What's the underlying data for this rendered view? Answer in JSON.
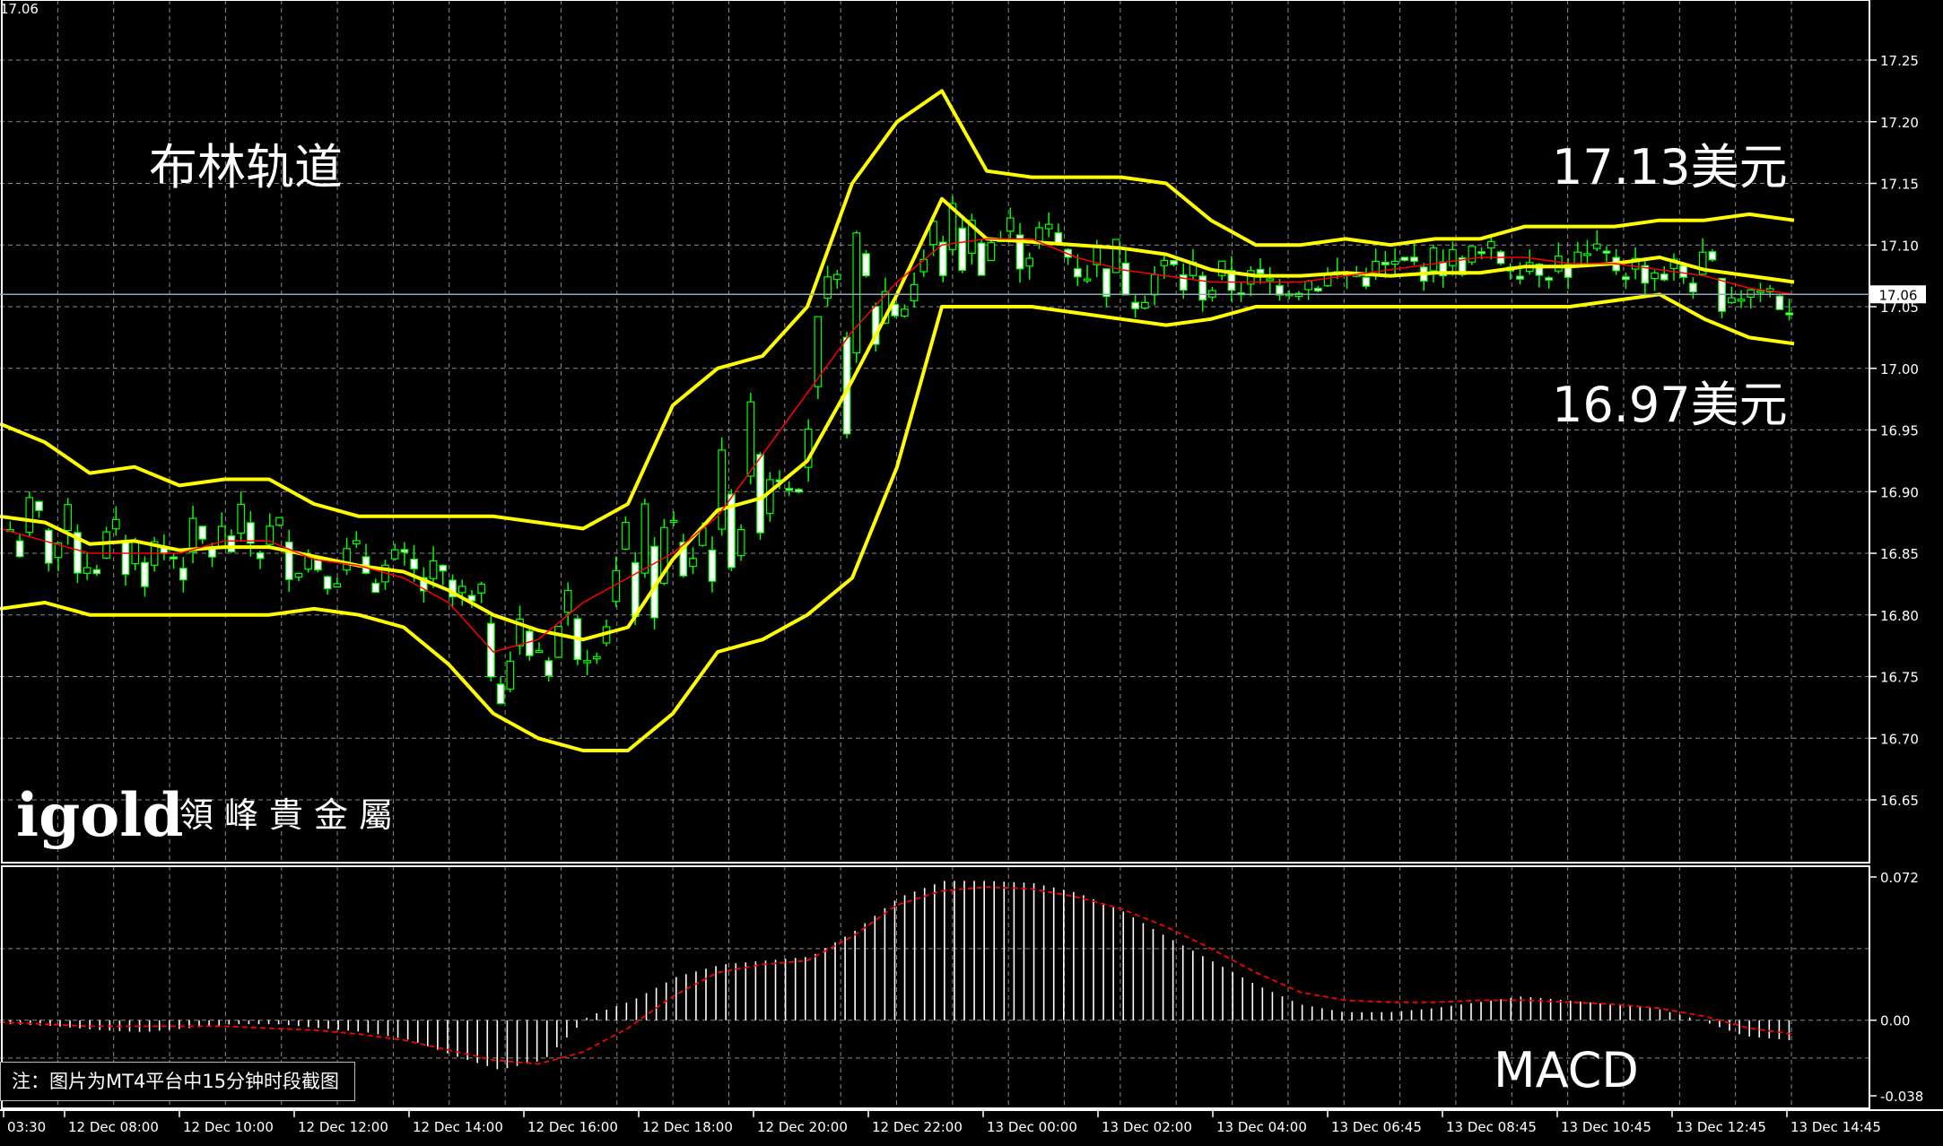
{
  "window": {
    "top_left_price": "17.06"
  },
  "annotations": {
    "bollinger_title": "布林轨道",
    "upper_value": "17.13美元",
    "lower_value": "16.97美元",
    "macd_title": "MACD"
  },
  "logo": {
    "brand": "igold",
    "chinese": "領峰貴金屬"
  },
  "note": "注：图片为MT4平台中15分钟时段截图",
  "colors": {
    "background": "#000000",
    "bull_candle": "#00ff00",
    "bear_candle": "#ffffff",
    "bands": "#ffff00",
    "middle_ma": "#ff0000",
    "macd_hist": "#ffffff",
    "macd_signal": "#ff0000",
    "grid": "#8a8a8a"
  },
  "chart_data": [
    {
      "type": "candlestick",
      "title": "布林轨道",
      "current_price": 17.06,
      "ylim": [
        16.62,
        17.31
      ],
      "y_ticks": [
        "17.25",
        "17.20",
        "17.15",
        "17.10",
        "17.05",
        "17.00",
        "16.95",
        "16.90",
        "16.85",
        "16.80",
        "16.75",
        "16.70",
        "16.65"
      ],
      "bands": {
        "upper": [
          16.955,
          16.94,
          16.915,
          16.92,
          16.905,
          16.91,
          16.91,
          16.89,
          16.88,
          16.88,
          16.88,
          16.88,
          16.875,
          16.87,
          16.89,
          16.97,
          17.0,
          17.01,
          17.05,
          17.15,
          17.2,
          17.225,
          17.16,
          17.155,
          17.155,
          17.155,
          17.15,
          17.12,
          17.1,
          17.1,
          17.105,
          17.1,
          17.105,
          17.105,
          17.115,
          17.115,
          17.115,
          17.12,
          17.12,
          17.125,
          17.12
        ],
        "middle": [
          16.87,
          16.86,
          16.85,
          16.85,
          16.85,
          16.86,
          16.86,
          16.845,
          16.84,
          16.83,
          16.81,
          16.77,
          16.78,
          16.81,
          16.83,
          16.85,
          16.88,
          16.93,
          16.98,
          17.03,
          17.07,
          17.1,
          17.105,
          17.105,
          17.09,
          17.08,
          17.075,
          17.07,
          17.07,
          17.07,
          17.075,
          17.08,
          17.085,
          17.09,
          17.09,
          17.085,
          17.085,
          17.08,
          17.075,
          17.065,
          17.06
        ],
        "lower": [
          16.805,
          16.81,
          16.8,
          16.8,
          16.8,
          16.8,
          16.8,
          16.805,
          16.8,
          16.79,
          16.76,
          16.72,
          16.7,
          16.69,
          16.69,
          16.72,
          16.77,
          16.78,
          16.8,
          16.83,
          16.92,
          17.05,
          17.05,
          17.05,
          17.045,
          17.04,
          17.035,
          17.04,
          17.05,
          17.05,
          17.05,
          17.05,
          17.05,
          17.05,
          17.05,
          17.05,
          17.055,
          17.06,
          17.04,
          17.025,
          17.02
        ]
      },
      "macd": {
        "ylim": [
          -0.038,
          0.072
        ],
        "y_ticks": [
          "0.072",
          "0.00",
          "-0.038"
        ],
        "histogram": [
          -0.002,
          -0.003,
          -0.005,
          -0.006,
          -0.004,
          -0.002,
          -0.002,
          -0.004,
          -0.006,
          -0.01,
          -0.018,
          -0.025,
          -0.02,
          0.002,
          0.01,
          0.022,
          0.028,
          0.03,
          0.032,
          0.045,
          0.062,
          0.07,
          0.07,
          0.069,
          0.064,
          0.055,
          0.042,
          0.03,
          0.018,
          0.008,
          0.004,
          0.004,
          0.006,
          0.009,
          0.012,
          0.01,
          0.008,
          0.006,
          0.0,
          -0.008,
          -0.01
        ],
        "signal": [
          -0.001,
          -0.002,
          -0.003,
          -0.003,
          -0.003,
          -0.003,
          -0.004,
          -0.005,
          -0.007,
          -0.01,
          -0.015,
          -0.02,
          -0.022,
          -0.016,
          -0.004,
          0.012,
          0.024,
          0.028,
          0.03,
          0.042,
          0.058,
          0.065,
          0.067,
          0.066,
          0.062,
          0.056,
          0.047,
          0.036,
          0.024,
          0.014,
          0.01,
          0.009,
          0.009,
          0.01,
          0.01,
          0.009,
          0.008,
          0.006,
          0.002,
          -0.004,
          -0.007
        ]
      },
      "x_labels": [
        "03:30",
        "12 Dec 08:00",
        "12 Dec 10:00",
        "12 Dec 12:00",
        "12 Dec 14:00",
        "12 Dec 16:00",
        "12 Dec 18:00",
        "12 Dec 20:00",
        "12 Dec 22:00",
        "13 Dec 00:00",
        "13 Dec 02:00",
        "13 Dec 04:00",
        "13 Dec 06:45",
        "13 Dec 08:45",
        "13 Dec 10:45",
        "13 Dec 12:45",
        "13 Dec 14:45"
      ]
    }
  ]
}
